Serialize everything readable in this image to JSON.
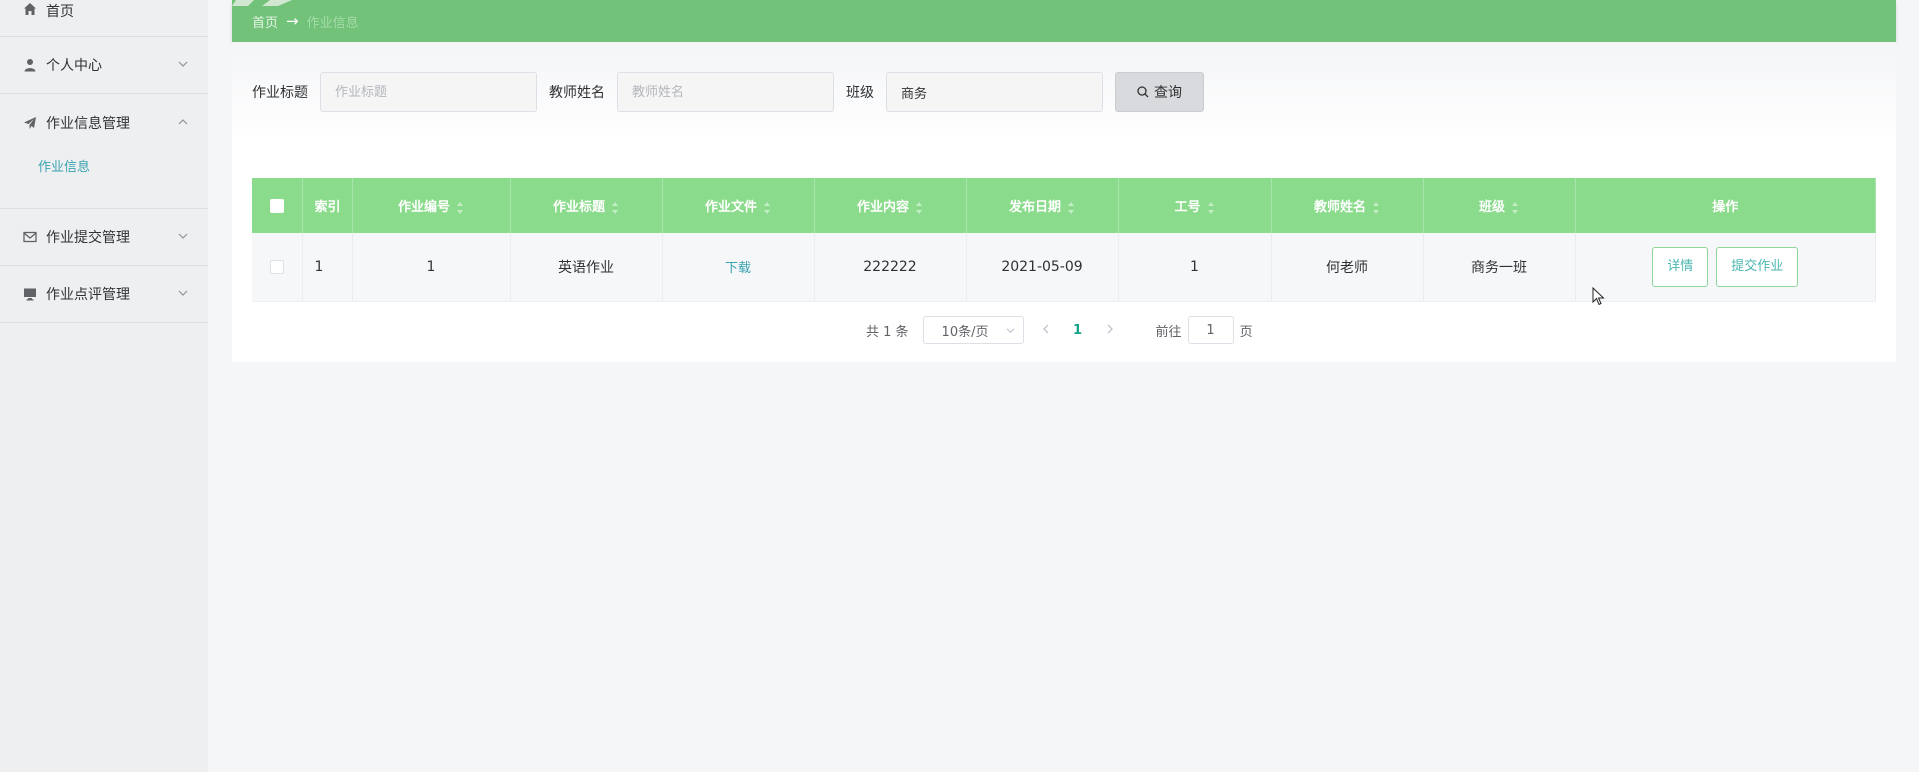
{
  "sidebar": {
    "items": [
      {
        "label": "首页",
        "icon": "home-icon"
      },
      {
        "label": "个人中心",
        "icon": "user-icon"
      },
      {
        "label": "作业信息管理",
        "icon": "send-icon",
        "submenu": [
          "作业信息"
        ]
      },
      {
        "label": "作业提交管理",
        "icon": "mail-icon"
      },
      {
        "label": "作业点评管理",
        "icon": "monitor-icon"
      }
    ]
  },
  "breadcrumb": {
    "home": "首页",
    "separator": "→",
    "current": "作业信息"
  },
  "search": {
    "title_label": "作业标题",
    "title_placeholder": "作业标题",
    "title_value": "",
    "teacher_label": "教师姓名",
    "teacher_placeholder": "教师姓名",
    "teacher_value": "",
    "class_label": "班级",
    "class_placeholder": "班级",
    "class_value": "商务",
    "query_button": "查询"
  },
  "table": {
    "columns": [
      "索引",
      "作业编号",
      "作业标题",
      "作业文件",
      "作业内容",
      "发布日期",
      "工号",
      "教师姓名",
      "班级",
      "操作"
    ],
    "rows": [
      {
        "index": "1",
        "number": "1",
        "title": "英语作业",
        "file": "下载",
        "content": "222222",
        "date": "2021-05-09",
        "staff_id": "1",
        "teacher": "何老师",
        "class": "商务一班",
        "detail_btn": "详情",
        "submit_btn": "提交作业"
      }
    ]
  },
  "pagination": {
    "total": "共 1 条",
    "page_size": "10条/页",
    "current_page": "1",
    "goto_label": "前往",
    "goto_value": "1",
    "goto_suffix": "页"
  },
  "colors": {
    "accent": "#73c27a",
    "header": "#8bdb8c",
    "link": "#3aa3b0"
  }
}
